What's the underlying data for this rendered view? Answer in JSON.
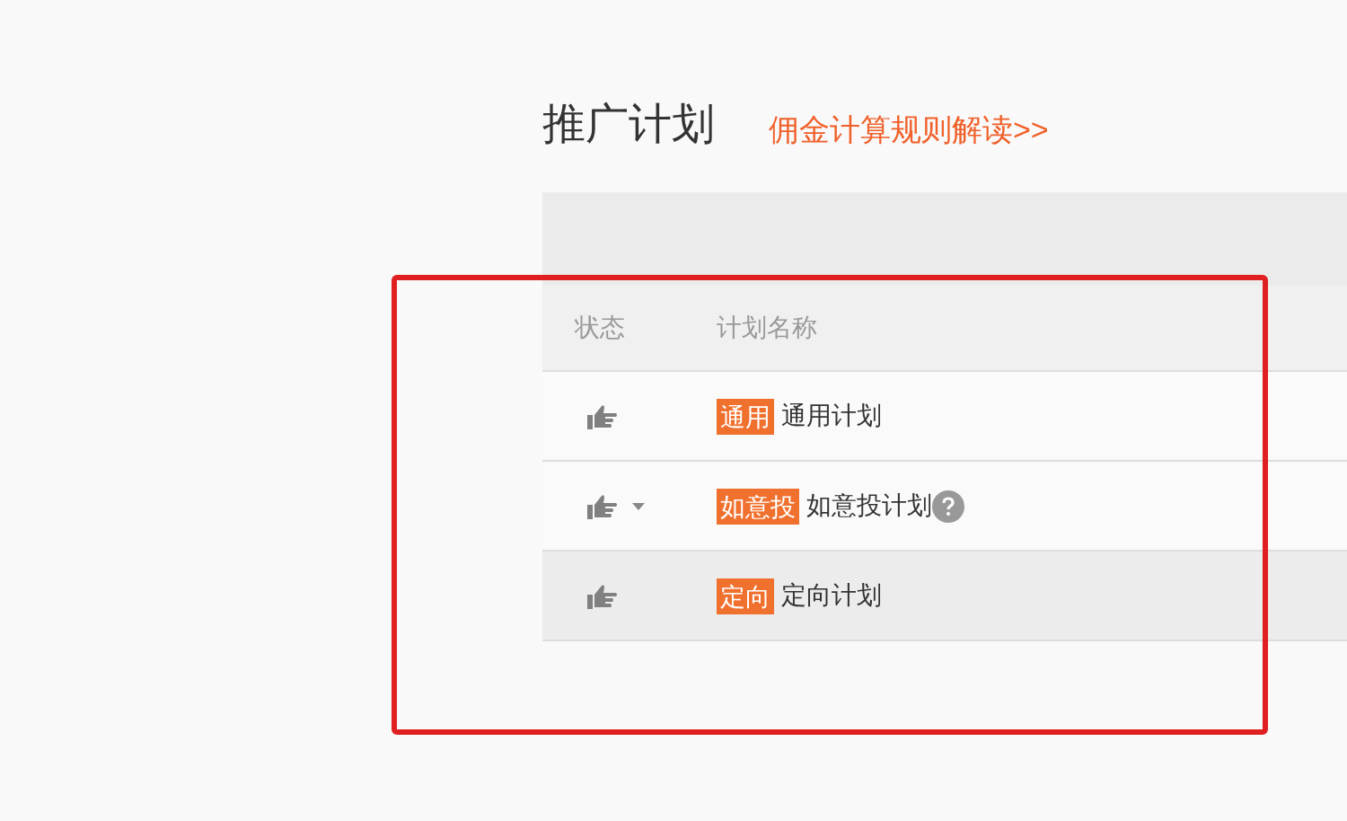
{
  "title": "推广计划",
  "rules_link": "佣金计算规则解读>>",
  "table": {
    "columns": [
      "状态",
      "计划名称"
    ],
    "rows": [
      {
        "tag": "通用",
        "name": "通用计划",
        "dropdown": false,
        "help": false,
        "highlighted": false
      },
      {
        "tag": "如意投",
        "name": "如意投计划",
        "dropdown": true,
        "help": true,
        "highlighted": false
      },
      {
        "tag": "定向",
        "name": "定向计划",
        "dropdown": false,
        "help": false,
        "highlighted": true
      }
    ]
  },
  "annotation": {
    "kind": "frame"
  }
}
